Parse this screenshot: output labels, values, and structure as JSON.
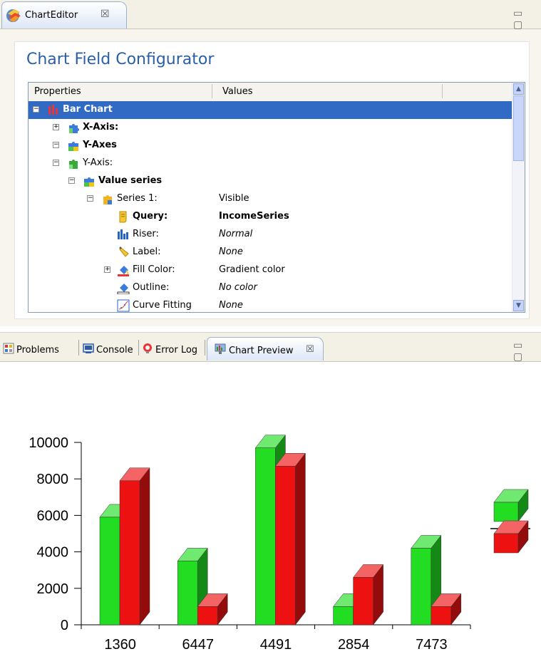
{
  "editor": {
    "tab_label": "ChartEditor",
    "tab_close": "☒",
    "window_buttons": "▭ ▢",
    "title": "Chart Field Configurator",
    "columns": [
      "Properties",
      "Values"
    ],
    "tree": [
      {
        "expander": "minus",
        "icon": "bar-chart-icon",
        "label": "Bar Chart",
        "value": "",
        "bold": true,
        "italic_value": false,
        "selected": true,
        "depth": 0
      },
      {
        "expander": "plus",
        "icon": "puzzle-blue-icon",
        "label": "X-Axis:",
        "value": "",
        "bold": true,
        "italic_value": false,
        "selected": false,
        "depth": 1
      },
      {
        "expander": "minus",
        "icon": "puzzle-multi-icon",
        "label": "Y-Axes",
        "value": "",
        "bold": true,
        "italic_value": false,
        "selected": false,
        "depth": 1
      },
      {
        "expander": "minus",
        "icon": "puzzle-green-icon",
        "label": "Y-Axis:",
        "value": "",
        "bold": false,
        "italic_value": false,
        "selected": false,
        "depth": 2
      },
      {
        "expander": "minus",
        "icon": "puzzle-multi-icon",
        "label": "Value series",
        "value": "",
        "bold": true,
        "italic_value": false,
        "selected": false,
        "depth": 3
      },
      {
        "expander": "minus",
        "icon": "puzzle-yellow-icon",
        "label": "Series 1:",
        "value": "Visible",
        "bold": false,
        "italic_value": false,
        "selected": false,
        "depth": 4
      },
      {
        "expander": "none",
        "icon": "query-icon",
        "label": "Query:",
        "value": "IncomeSeries",
        "bold": true,
        "italic_value": false,
        "selected": false,
        "depth": 5
      },
      {
        "expander": "none",
        "icon": "riser-icon",
        "label": "Riser:",
        "value": "Normal",
        "bold": false,
        "italic_value": true,
        "selected": false,
        "depth": 5
      },
      {
        "expander": "none",
        "icon": "label-icon",
        "label": "Label:",
        "value": "None",
        "bold": false,
        "italic_value": true,
        "selected": false,
        "depth": 5
      },
      {
        "expander": "plus",
        "icon": "fill-color-icon",
        "label": "Fill Color:",
        "value": "Gradient color",
        "bold": false,
        "italic_value": false,
        "selected": false,
        "depth": 5
      },
      {
        "expander": "none",
        "icon": "outline-icon",
        "label": "Outline:",
        "value": "No color",
        "bold": false,
        "italic_value": true,
        "selected": false,
        "depth": 5
      },
      {
        "expander": "none",
        "icon": "curve-fitting-icon",
        "label": "Curve Fitting",
        "value": "None",
        "bold": false,
        "italic_value": true,
        "selected": false,
        "depth": 5
      }
    ]
  },
  "bottom": {
    "tabs": [
      {
        "label": "Problems",
        "icon": "problems-icon",
        "active": false
      },
      {
        "label": "Console",
        "icon": "console-icon",
        "active": false
      },
      {
        "label": "Error Log",
        "icon": "error-log-icon",
        "active": false
      },
      {
        "label": "Chart Preview",
        "icon": "chart-preview-icon",
        "active": true
      }
    ],
    "tab_close": "☒",
    "window_buttons": "▭ ▢"
  },
  "colors": {
    "selection": "#316ac5",
    "title": "#2b5ea8",
    "series_green": "#22dd22",
    "series_red": "#ee1111"
  },
  "chart_data": {
    "type": "bar",
    "style": "3d",
    "categories": [
      "1360",
      "6447",
      "4491",
      "2854",
      "7473"
    ],
    "series": [
      {
        "values": [
          5900,
          3500,
          9700,
          1000,
          4200
        ],
        "color": "#22dd22"
      },
      {
        "values": [
          7900,
          1000,
          8700,
          2600,
          1000
        ],
        "color": "#ee1111"
      }
    ],
    "yticks": [
      "0",
      "2000",
      "4000",
      "6000",
      "8000",
      "10000"
    ],
    "ylim": [
      0,
      10000
    ],
    "legend": "right",
    "grid": false
  }
}
